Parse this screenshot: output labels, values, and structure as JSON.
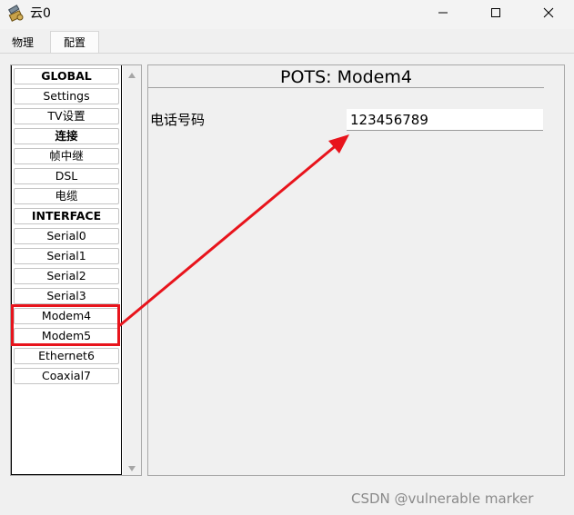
{
  "window": {
    "title": "云0",
    "icon": "cloud-tools-icon",
    "controls": [
      "minimize-icon",
      "maximize-icon",
      "close-icon"
    ]
  },
  "tabs": [
    {
      "label": "物理",
      "active": false
    },
    {
      "label": "配置",
      "active": true
    }
  ],
  "sidebar": {
    "items": [
      {
        "label": "GLOBAL",
        "header": true
      },
      {
        "label": "Settings",
        "header": false
      },
      {
        "label": "TV设置",
        "header": false
      },
      {
        "label": "连接",
        "header": true
      },
      {
        "label": "帧中继",
        "header": false
      },
      {
        "label": "DSL",
        "header": false
      },
      {
        "label": "电缆",
        "header": false
      },
      {
        "label": "INTERFACE",
        "header": true
      },
      {
        "label": "Serial0",
        "header": false
      },
      {
        "label": "Serial1",
        "header": false
      },
      {
        "label": "Serial2",
        "header": false
      },
      {
        "label": "Serial3",
        "header": false
      },
      {
        "label": "Modem4",
        "header": false
      },
      {
        "label": "Modem5",
        "header": false
      },
      {
        "label": "Ethernet6",
        "header": false
      },
      {
        "label": "Coaxial7",
        "header": false
      }
    ]
  },
  "panel": {
    "title": "POTS: Modem4",
    "phone_label": "电话号码",
    "phone_value": "123456789"
  },
  "annotation": {
    "highlight_color": "#e8141c"
  },
  "watermark": "CSDN @vulnerable marker"
}
